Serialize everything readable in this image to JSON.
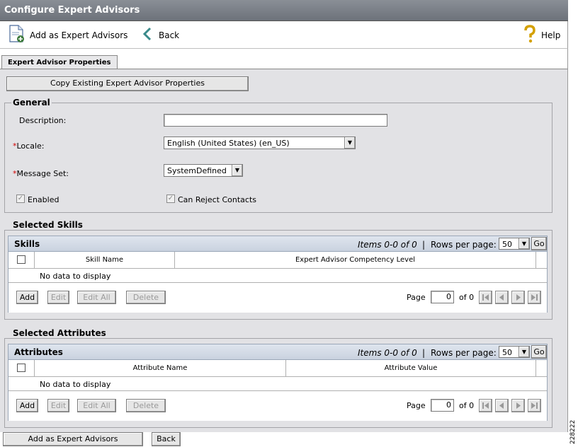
{
  "window": {
    "title": "Configure Expert Advisors"
  },
  "toolbar": {
    "add_label": "Add as Expert Advisors",
    "back_label": "Back",
    "help_label": "Help"
  },
  "tabs": [
    {
      "label": "Expert Advisor Properties"
    }
  ],
  "copy_button": "Copy Existing Expert Advisor Properties",
  "general": {
    "legend": "General",
    "description_label": "Description:",
    "description_value": "",
    "required_marker": "*",
    "locale_label": "Locale:",
    "locale_value": "English (United States) (en_US)",
    "message_set_label": "Message Set:",
    "message_set_value": "SystemDefined",
    "enabled_label": "Enabled",
    "enabled_checked": true,
    "can_reject_label": "Can Reject Contacts",
    "can_reject_checked": true
  },
  "skills": {
    "legend": "Selected Skills",
    "grid_title": "Skills",
    "items_text": "Items 0-0 of 0",
    "separator": "|",
    "rows_per_page_label": "Rows per page:",
    "rows_per_page_value": "50",
    "go_label": "Go",
    "columns": [
      "Skill Name",
      "Expert Advisor Competency Level"
    ],
    "empty_text": "No data to display",
    "buttons": {
      "add": "Add",
      "edit": "Edit",
      "edit_all": "Edit All",
      "delete": "Delete"
    },
    "page_label": "Page",
    "page_value": "0",
    "of_text": "of 0"
  },
  "attributes": {
    "legend": "Selected Attributes",
    "grid_title": "Attributes",
    "items_text": "Items 0-0 of 0",
    "separator": "|",
    "rows_per_page_label": "Rows per page:",
    "rows_per_page_value": "50",
    "go_label": "Go",
    "columns": [
      "Attribute Name",
      "Attribute Value"
    ],
    "empty_text": "No data to display",
    "buttons": {
      "add": "Add",
      "edit": "Edit",
      "edit_all": "Edit All",
      "delete": "Delete"
    },
    "page_label": "Page",
    "page_value": "0",
    "of_text": "of 0"
  },
  "footer": {
    "add_label": "Add as Expert Advisors",
    "back_label": "Back"
  },
  "figure_id": "228222"
}
